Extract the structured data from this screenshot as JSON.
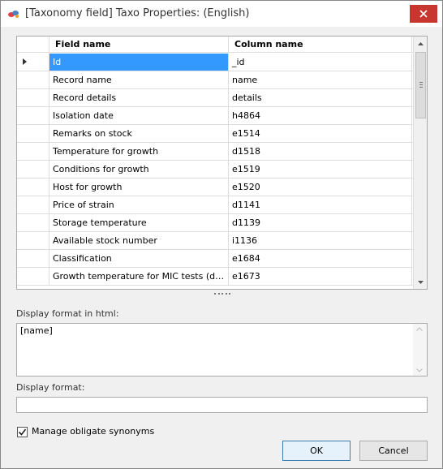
{
  "window": {
    "title": "[Taxonomy field] Taxo Properties: (English)",
    "close_color": "#c7372f"
  },
  "grid": {
    "columns": [
      "Field name",
      "Column name"
    ],
    "selected_row": 0,
    "rows": [
      {
        "field": "Id",
        "column": "_id"
      },
      {
        "field": "Record name",
        "column": "name"
      },
      {
        "field": "Record details",
        "column": "details"
      },
      {
        "field": "Isolation date",
        "column": "h4864"
      },
      {
        "field": "Remarks on stock",
        "column": "e1514"
      },
      {
        "field": "Temperature for growth",
        "column": "d1518"
      },
      {
        "field": "Conditions for growth",
        "column": "e1519"
      },
      {
        "field": "Host for growth",
        "column": "e1520"
      },
      {
        "field": "Price of strain",
        "column": "d1141"
      },
      {
        "field": "Storage temperature",
        "column": "d1139"
      },
      {
        "field": "Available stock number",
        "column": "i1136"
      },
      {
        "field": "Classification",
        "column": "e1684"
      },
      {
        "field": "Growth temperature for MIC tests (deg ...",
        "column": "e1673"
      }
    ]
  },
  "html_format": {
    "label": "Display format in html:",
    "value": "[name]"
  },
  "display_format": {
    "label": "Display format:",
    "value": ""
  },
  "manage_synonyms": {
    "label": "Manage obligate synonyms",
    "checked": true
  },
  "buttons": {
    "ok": "OK",
    "cancel": "Cancel"
  },
  "accent_color": "#3399ff"
}
